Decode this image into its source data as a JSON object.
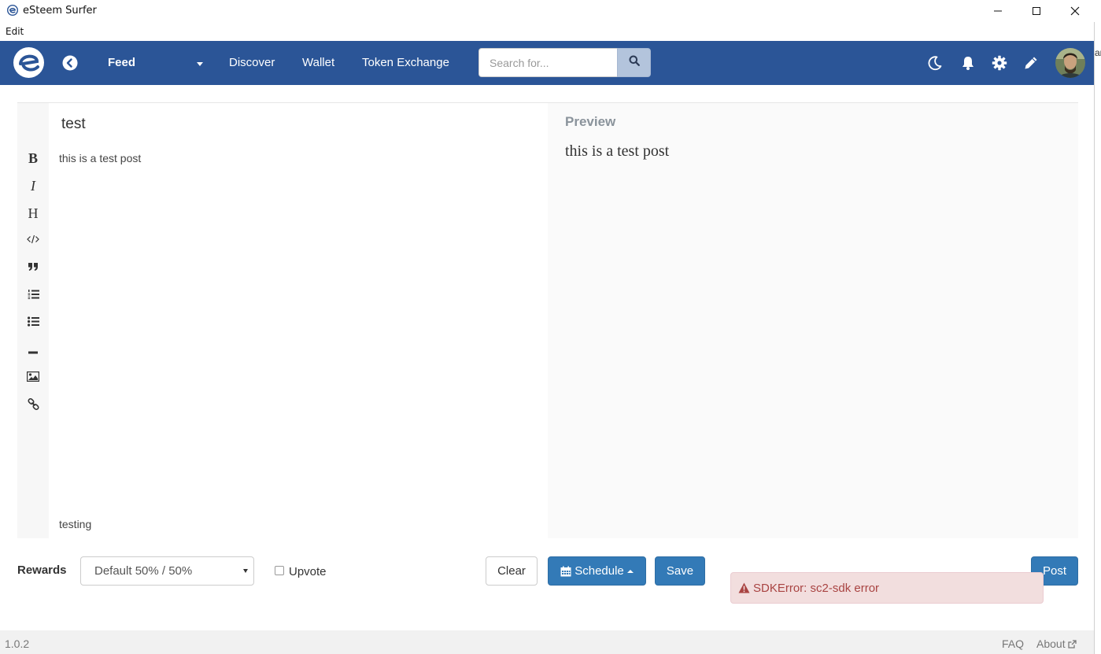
{
  "window": {
    "title": "eSteem Surfer",
    "menu_edit": "Edit",
    "side_clip_text": "ar"
  },
  "navbar": {
    "feed_label": "Feed",
    "discover_label": "Discover",
    "wallet_label": "Wallet",
    "token_exchange_label": "Token Exchange",
    "search_placeholder": "Search for..."
  },
  "editor": {
    "title_value": "test",
    "body_value": "this is a test post",
    "tags_value": "testing",
    "toolbar": [
      "bold",
      "italic",
      "heading",
      "code",
      "quote",
      "ordered-list",
      "unordered-list",
      "horizontal-rule",
      "image",
      "link"
    ],
    "toolbar_labels": {
      "bold": "B",
      "italic": "I",
      "heading": "H"
    }
  },
  "preview": {
    "label": "Preview",
    "body": "this is a test post"
  },
  "footer": {
    "rewards_label": "Rewards",
    "rewards_selected": "Default 50% / 50%",
    "upvote_label": "Upvote",
    "clear_label": "Clear",
    "schedule_label": "Schedule",
    "save_label": "Save",
    "post_label": "Post"
  },
  "alert": {
    "message": "SDKError: sc2-sdk error"
  },
  "statusbar": {
    "version": "1.0.2",
    "faq_label": "FAQ",
    "about_label": "About"
  },
  "colors": {
    "navbar": "#2b5597",
    "primary_button": "#337ab7",
    "alert_bg": "#f2dede",
    "alert_text": "#a94442"
  }
}
